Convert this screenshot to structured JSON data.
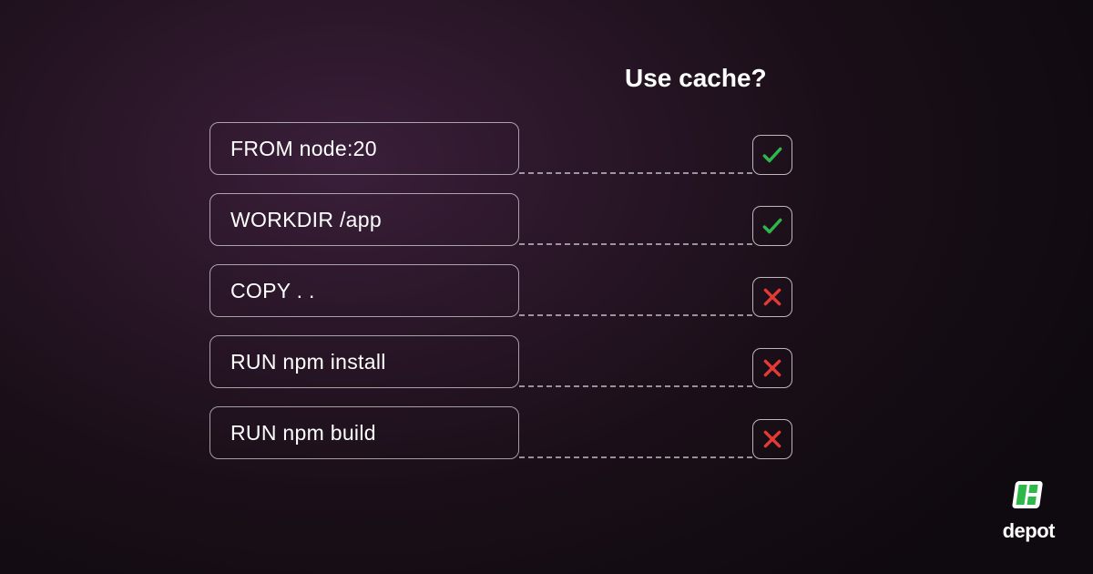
{
  "header": "Use cache?",
  "steps": [
    {
      "label": "FROM node:20",
      "cached": true
    },
    {
      "label": "WORKDIR /app",
      "cached": true
    },
    {
      "label": "COPY . .",
      "cached": false
    },
    {
      "label": "RUN npm install",
      "cached": false
    },
    {
      "label": "RUN npm build",
      "cached": false
    }
  ],
  "brand": {
    "name": "depot"
  },
  "colors": {
    "check": "#2fb84a",
    "cross": "#e53935",
    "brand_accent": "#2fb84a"
  }
}
